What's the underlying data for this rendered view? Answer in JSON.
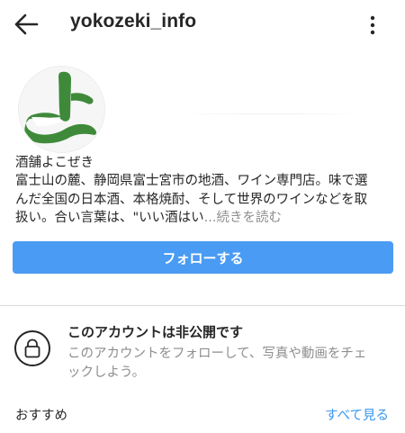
{
  "header": {
    "username": "yokozeki_info",
    "back_icon": "arrow-left-icon",
    "more_icon": "more-vertical-icon"
  },
  "profile": {
    "avatar_text": "よ",
    "avatar_color": "#3e8a3a",
    "display_name": "酒舗よこぜき",
    "bio_lines": [
      "富士山の麓、静岡県富士宮市の地酒、ワイン専門店。味で選",
      "んだ全国の日本酒、本格焼酎、そして世界のワインなどを取",
      "扱い。合い言葉は、\"いい酒はい"
    ],
    "bio_ellipsis": "...",
    "more_label": "続きを読む"
  },
  "follow_button": {
    "label": "フォローする",
    "color": "#4a9bf3"
  },
  "private": {
    "icon": "lock-icon",
    "title": "このアカウントは非公開です",
    "description_lines": [
      "このアカウントをフォローして、写真や動画をチェ",
      "ックしよう。"
    ]
  },
  "suggestions": {
    "label": "おすすめ",
    "see_all": "すべて見る",
    "link_color": "#3897f0"
  }
}
